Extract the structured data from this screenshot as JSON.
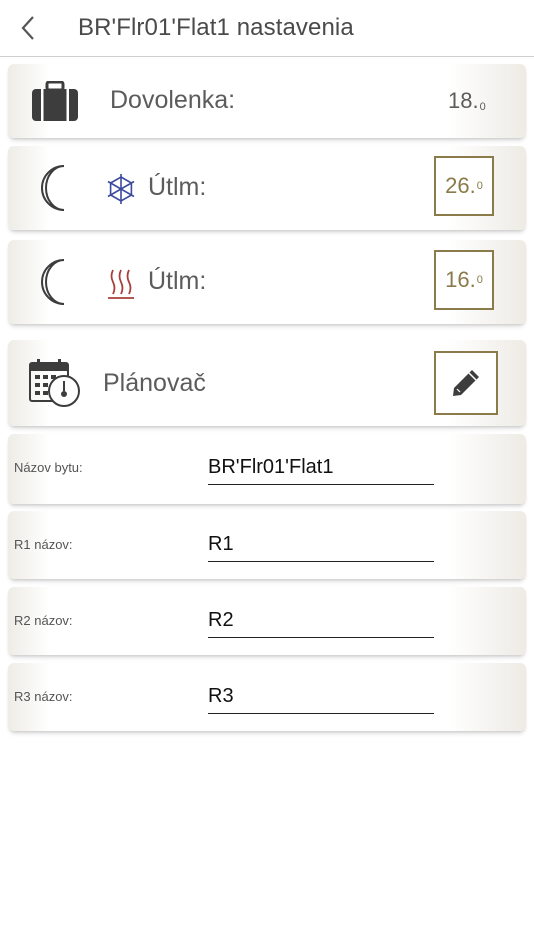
{
  "header": {
    "back_icon": "chevron-left-icon",
    "title": "BR'Flr01'Flat1 nastavenia"
  },
  "vacation": {
    "icon": "suitcase-icon",
    "label": "Dovolenka:",
    "value_int": "18.",
    "value_dec": "0"
  },
  "cooling_setback": {
    "icon": "moon-icon",
    "mode_icon": "snowflake-icon",
    "label": "Útlm:",
    "value_int": "26.",
    "value_dec": "0",
    "color": "#3b4a9e"
  },
  "heating_setback": {
    "icon": "moon-icon",
    "mode_icon": "heat-waves-icon",
    "label": "Útlm:",
    "value_int": "16.",
    "value_dec": "0",
    "color": "#a8403a"
  },
  "scheduler": {
    "icon": "calendar-clock-icon",
    "label": "Plánovač",
    "edit_icon": "pencil-icon"
  },
  "fields": [
    {
      "label": "Názov bytu:",
      "value": "BR'Flr01'Flat1"
    },
    {
      "label": "R1 názov:",
      "value": "R1"
    },
    {
      "label": "R2 názov:",
      "value": "R2"
    },
    {
      "label": "R3 názov:",
      "value": "R3"
    }
  ],
  "colors": {
    "accent_gold": "#8b7a4a",
    "text_gray": "#5c5c5c"
  }
}
